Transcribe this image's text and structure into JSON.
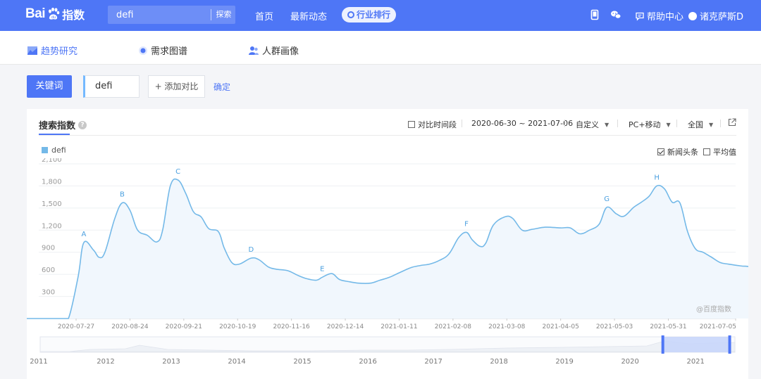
{
  "topbar": {
    "logo_text_bai": "Bai",
    "logo_text_zhi": "指数",
    "search_value": "defi",
    "search_button": "探索",
    "nav": [
      "首页",
      "最新动态"
    ],
    "nav_pill": "行业排行",
    "help": "帮助中心",
    "user": "诸克萨斯D",
    "icons": [
      "mobile-icon",
      "wechat-icon",
      "help-chat-icon",
      "user-avatar"
    ]
  },
  "subnav": {
    "items": [
      {
        "label": "趋势研究",
        "icon": "trend-chart-icon"
      },
      {
        "label": "需求图谱",
        "icon": "radar-icon"
      },
      {
        "label": "人群画像",
        "icon": "people-icon"
      }
    ]
  },
  "keyword": {
    "tab_label": "关键词",
    "value": "defi",
    "add_compare": "+ 添加对比",
    "confirm": "确定"
  },
  "panel": {
    "title": "搜索指数",
    "help": "?",
    "compare_period": "对比时间段",
    "date_range": "2020-06-30 ~ 2021-07-06",
    "custom": "自定义",
    "device": "PC+移动",
    "region": "全国",
    "legend": "defi",
    "news_option": "新闻头条",
    "avg_option": "平均值",
    "watermark": "@百度指数",
    "colors": {
      "accent": "#4e76f6",
      "line": "#74b9e8",
      "fill": "#f1f7fd"
    }
  },
  "chart_data": {
    "type": "area",
    "series": [
      {
        "name": "defi"
      }
    ],
    "ylim": [
      0,
      2100
    ],
    "yticks": [
      "2,100",
      "1,800",
      "1,500",
      "1,200",
      "900",
      "600",
      "300"
    ],
    "xticks": [
      "2020-07-27",
      "2020-08-24",
      "2020-09-21",
      "2020-10-19",
      "2020-11-16",
      "2020-12-14",
      "2021-01-11",
      "2021-02-08",
      "2021-03-08",
      "2021-04-05",
      "2021-05-03",
      "2021-05-31",
      "2021-07-05"
    ],
    "x_start": "2020-06-30",
    "x_end": "2021-07-06",
    "points": [
      [
        "2020-06-30",
        0
      ],
      [
        "2020-07-19",
        0
      ],
      [
        "2020-07-23",
        0
      ],
      [
        "2020-07-28",
        560
      ],
      [
        "2020-07-31",
        1030
      ],
      [
        "2020-08-05",
        930
      ],
      [
        "2020-08-08",
        830
      ],
      [
        "2020-08-11",
        900
      ],
      [
        "2020-08-16",
        1350
      ],
      [
        "2020-08-20",
        1570
      ],
      [
        "2020-08-24",
        1470
      ],
      [
        "2020-08-28",
        1200
      ],
      [
        "2020-09-02",
        1130
      ],
      [
        "2020-09-07",
        1040
      ],
      [
        "2020-09-10",
        1200
      ],
      [
        "2020-09-14",
        1800
      ],
      [
        "2020-09-18",
        1880
      ],
      [
        "2020-09-22",
        1700
      ],
      [
        "2020-09-26",
        1450
      ],
      [
        "2020-09-30",
        1380
      ],
      [
        "2020-10-04",
        1220
      ],
      [
        "2020-10-09",
        1180
      ],
      [
        "2020-10-12",
        960
      ],
      [
        "2020-10-16",
        760
      ],
      [
        "2020-10-20",
        740
      ],
      [
        "2020-10-26",
        820
      ],
      [
        "2020-10-30",
        800
      ],
      [
        "2020-11-04",
        700
      ],
      [
        "2020-11-08",
        670
      ],
      [
        "2020-11-14",
        650
      ],
      [
        "2020-11-19",
        590
      ],
      [
        "2020-11-24",
        540
      ],
      [
        "2020-11-29",
        520
      ],
      [
        "2020-12-02",
        560
      ],
      [
        "2020-12-07",
        610
      ],
      [
        "2020-12-11",
        530
      ],
      [
        "2020-12-16",
        500
      ],
      [
        "2020-12-21",
        480
      ],
      [
        "2020-12-27",
        480
      ],
      [
        "2021-01-01",
        520
      ],
      [
        "2021-01-06",
        560
      ],
      [
        "2021-01-11",
        620
      ],
      [
        "2021-01-17",
        690
      ],
      [
        "2021-01-22",
        720
      ],
      [
        "2021-01-27",
        740
      ],
      [
        "2021-02-01",
        790
      ],
      [
        "2021-02-06",
        880
      ],
      [
        "2021-02-11",
        1100
      ],
      [
        "2021-02-15",
        1170
      ],
      [
        "2021-02-18",
        1070
      ],
      [
        "2021-02-22",
        980
      ],
      [
        "2021-02-25",
        1020
      ],
      [
        "2021-03-01",
        1270
      ],
      [
        "2021-03-07",
        1380
      ],
      [
        "2021-03-11",
        1360
      ],
      [
        "2021-03-16",
        1200
      ],
      [
        "2021-03-21",
        1210
      ],
      [
        "2021-03-28",
        1240
      ],
      [
        "2021-04-05",
        1230
      ],
      [
        "2021-04-10",
        1230
      ],
      [
        "2021-04-15",
        1150
      ],
      [
        "2021-04-20",
        1200
      ],
      [
        "2021-04-25",
        1280
      ],
      [
        "2021-04-29",
        1510
      ],
      [
        "2021-05-04",
        1420
      ],
      [
        "2021-05-08",
        1390
      ],
      [
        "2021-05-13",
        1510
      ],
      [
        "2021-05-17",
        1580
      ],
      [
        "2021-05-21",
        1660
      ],
      [
        "2021-05-25",
        1800
      ],
      [
        "2021-05-29",
        1760
      ],
      [
        "2021-06-02",
        1580
      ],
      [
        "2021-06-06",
        1570
      ],
      [
        "2021-06-10",
        1180
      ],
      [
        "2021-06-14",
        950
      ],
      [
        "2021-06-18",
        900
      ],
      [
        "2021-06-22",
        840
      ],
      [
        "2021-06-27",
        760
      ],
      [
        "2021-07-01",
        740
      ],
      [
        "2021-07-06",
        720
      ],
      [
        "2021-07-10",
        710
      ],
      [
        "2021-07-15",
        720
      ],
      [
        "2021-07-20",
        850
      ],
      [
        "2021-07-23",
        860
      ]
    ],
    "annotations": [
      {
        "label": "A",
        "date": "2020-07-31",
        "value": 1030
      },
      {
        "label": "B",
        "date": "2020-08-20",
        "value": 1570
      },
      {
        "label": "C",
        "date": "2020-09-18",
        "value": 1880
      },
      {
        "label": "D",
        "date": "2020-10-26",
        "value": 820
      },
      {
        "label": "E",
        "date": "2020-12-02",
        "value": 560
      },
      {
        "label": "F",
        "date": "2021-02-15",
        "value": 1170
      },
      {
        "label": "G",
        "date": "2021-04-29",
        "value": 1510
      },
      {
        "label": "H",
        "date": "2021-05-25",
        "value": 1800
      }
    ],
    "grid": true,
    "legend_position": "top-left",
    "navigator": {
      "years": [
        "2011",
        "2012",
        "2013",
        "2014",
        "2015",
        "2016",
        "2017",
        "2018",
        "2019",
        "2020",
        "2021"
      ],
      "range_start": 2011.0,
      "range_end": 2021.6,
      "selected_start": 2020.5,
      "selected_end": 2021.52
    }
  }
}
